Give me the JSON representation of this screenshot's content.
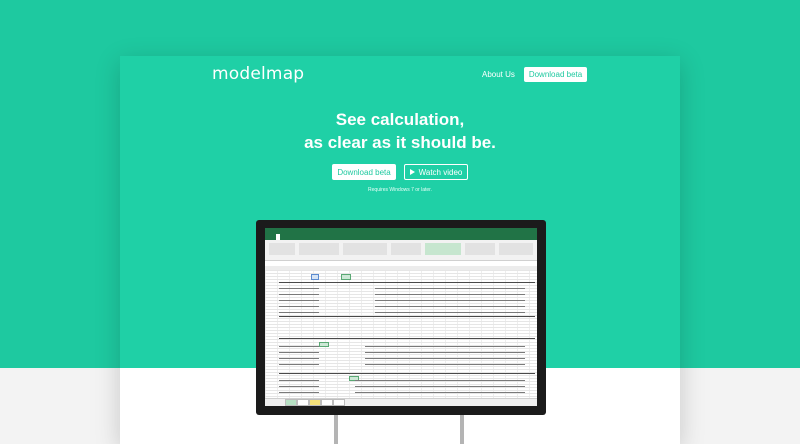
{
  "brand": {
    "logo_text": "modelmap"
  },
  "nav": {
    "about_label": "About Us",
    "download_label": "Download beta"
  },
  "hero": {
    "headline_line1": "See calculation,",
    "headline_line2": "as clear as it should be.",
    "download_label": "Download beta",
    "watch_label": "Watch video",
    "requirements": "Requires Windows 7 or later."
  },
  "colors": {
    "accent": "#1fd0a6",
    "page_bg": "#1ec9a0",
    "button_text": "#1fc9a0"
  },
  "icons": {
    "play": "play-icon"
  }
}
